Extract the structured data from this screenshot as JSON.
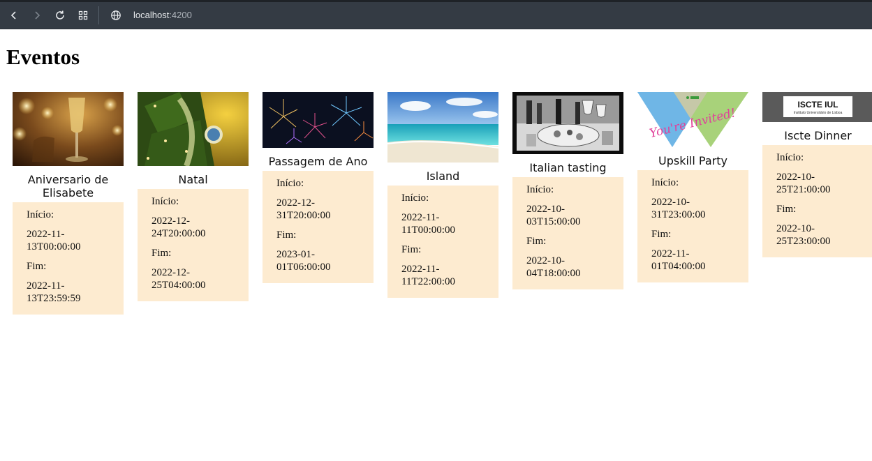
{
  "browser": {
    "url_host": "localhost",
    "url_port": ":4200"
  },
  "page": {
    "title": "Eventos"
  },
  "labels": {
    "start": "Início:",
    "end": "Fim:"
  },
  "events": [
    {
      "name": "Aniversario de Elisabete",
      "start": "2022-11-13T00:00:00",
      "end": "2022-11-13T23:59:59",
      "image": "champagne-candles-image"
    },
    {
      "name": "Natal",
      "start": "2022-12-24T20:00:00",
      "end": "2022-12-25T04:00:00",
      "image": "christmas-tree-image"
    },
    {
      "name": "Passagem de Ano",
      "start": "2022-12-31T20:00:00",
      "end": "2023-01-01T06:00:00",
      "image": "fireworks-image"
    },
    {
      "name": "Island",
      "start": "2022-11-11T00:00:00",
      "end": "2022-11-11T22:00:00",
      "image": "beach-image"
    },
    {
      "name": "Italian tasting",
      "start": "2022-10-03T15:00:00",
      "end": "2022-10-04T18:00:00",
      "image": "wine-table-image"
    },
    {
      "name": "Upskill Party",
      "start": "2022-10-31T23:00:00",
      "end": "2022-11-01T04:00:00",
      "image": "youre-invited-image",
      "image_text": "You're Invited!"
    },
    {
      "name": "Iscte Dinner",
      "start": "2022-10-25T21:00:00",
      "end": "2022-10-25T23:00:00",
      "image": "iscte-logo-image",
      "image_text": "ISCTE IUL",
      "image_subtext": "Instituto Universitário de Lisboa"
    }
  ]
}
